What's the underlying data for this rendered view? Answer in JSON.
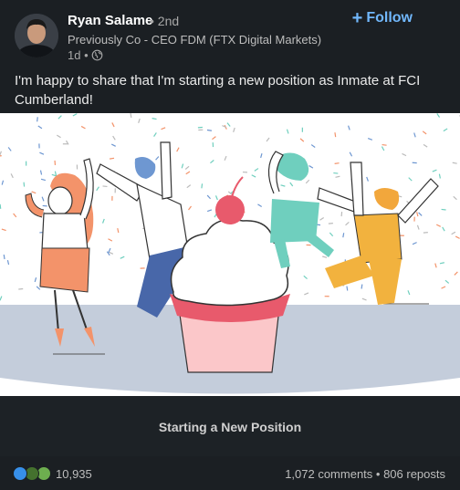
{
  "author": {
    "name": "Ryan Salame",
    "degree": "• 2nd",
    "headline": "Previously Co - CEO FDM (FTX Digital Markets)",
    "time": "1d •"
  },
  "follow_label": "Follow",
  "post_text": "I'm happy to share that I'm starting a new position as Inmate at FCI Cumberland!",
  "image_caption": "Starting a New Position",
  "social": {
    "reactions_count": "10,935",
    "comments_reposts": "1,072 comments • 806 reposts"
  },
  "colors": {
    "background": "#1b1f23",
    "follow_blue": "#71b7fb",
    "like_blue": "#378fe9",
    "celebrate_green": "#44712e",
    "support_purple": "#6dae4f"
  },
  "icons": [
    "globe-icon",
    "plus-icon",
    "like-reaction-icon",
    "celebrate-reaction-icon",
    "support-reaction-icon"
  ]
}
